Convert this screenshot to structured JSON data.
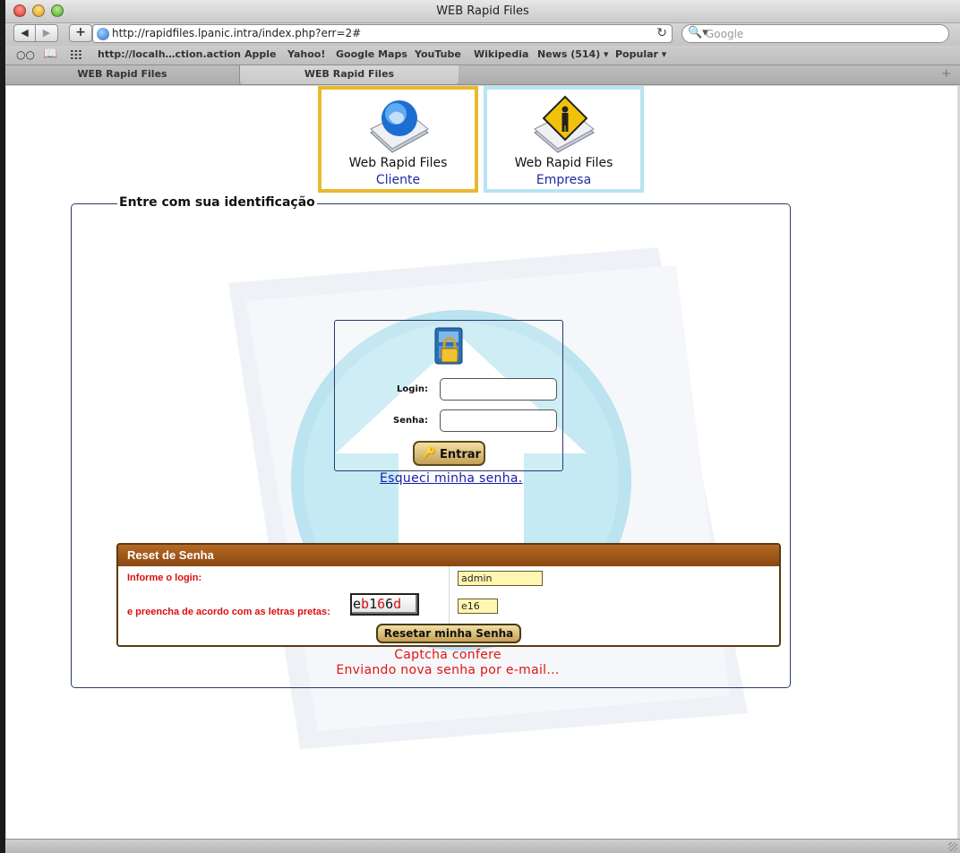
{
  "window": {
    "title": "WEB Rapid Files"
  },
  "toolbar": {
    "back": "◀",
    "forward": "▶",
    "add": "+",
    "url": "http://rapidfiles.lpanic.intra/index.php?err=2#",
    "reload": "↻",
    "search_placeholder": "Google",
    "search_glyph": "🔍▾"
  },
  "bookmarks": {
    "reader": "○○",
    "book": "📖",
    "items": [
      "http://localh…ction.action",
      "Apple",
      "Yahoo!",
      "Google Maps",
      "YouTube",
      "Wikipedia",
      "News (514) ▾",
      "Popular ▾"
    ]
  },
  "tabs": {
    "items": [
      "WEB Rapid Files",
      "WEB Rapid Files"
    ],
    "new_tab": "+"
  },
  "tiles": [
    {
      "title": "Web Rapid Files",
      "subtitle": "Cliente",
      "icon": "globe-document-icon",
      "border_color": "#e9b82f"
    },
    {
      "title": "Web Rapid Files",
      "subtitle": "Empresa",
      "icon": "person-sign-document-icon",
      "border_color": "#b8e4f2"
    }
  ],
  "identification": {
    "legend": "Entre com sua identificação",
    "login_label": "Login:",
    "senha_label": "Senha:",
    "login_value": "",
    "senha_value": "",
    "submit": "Entrar",
    "forgot": "Esqueci minha senha."
  },
  "reset": {
    "title": "Reset de Senha",
    "informe_label": "Informe o login:",
    "preencha_label": "e preencha de acordo com as letras pretas:",
    "captcha_text": "eb166d",
    "login_value": "admin",
    "captcha_value": "e16",
    "button": "Resetar minha Senha"
  },
  "messages": [
    "Captcha confere",
    "Enviando nova senha por e-mail..."
  ],
  "colors": {
    "accent": "#e9b82f",
    "header": "#8a4612",
    "error": "#e01414",
    "link": "#1a1aa8"
  }
}
